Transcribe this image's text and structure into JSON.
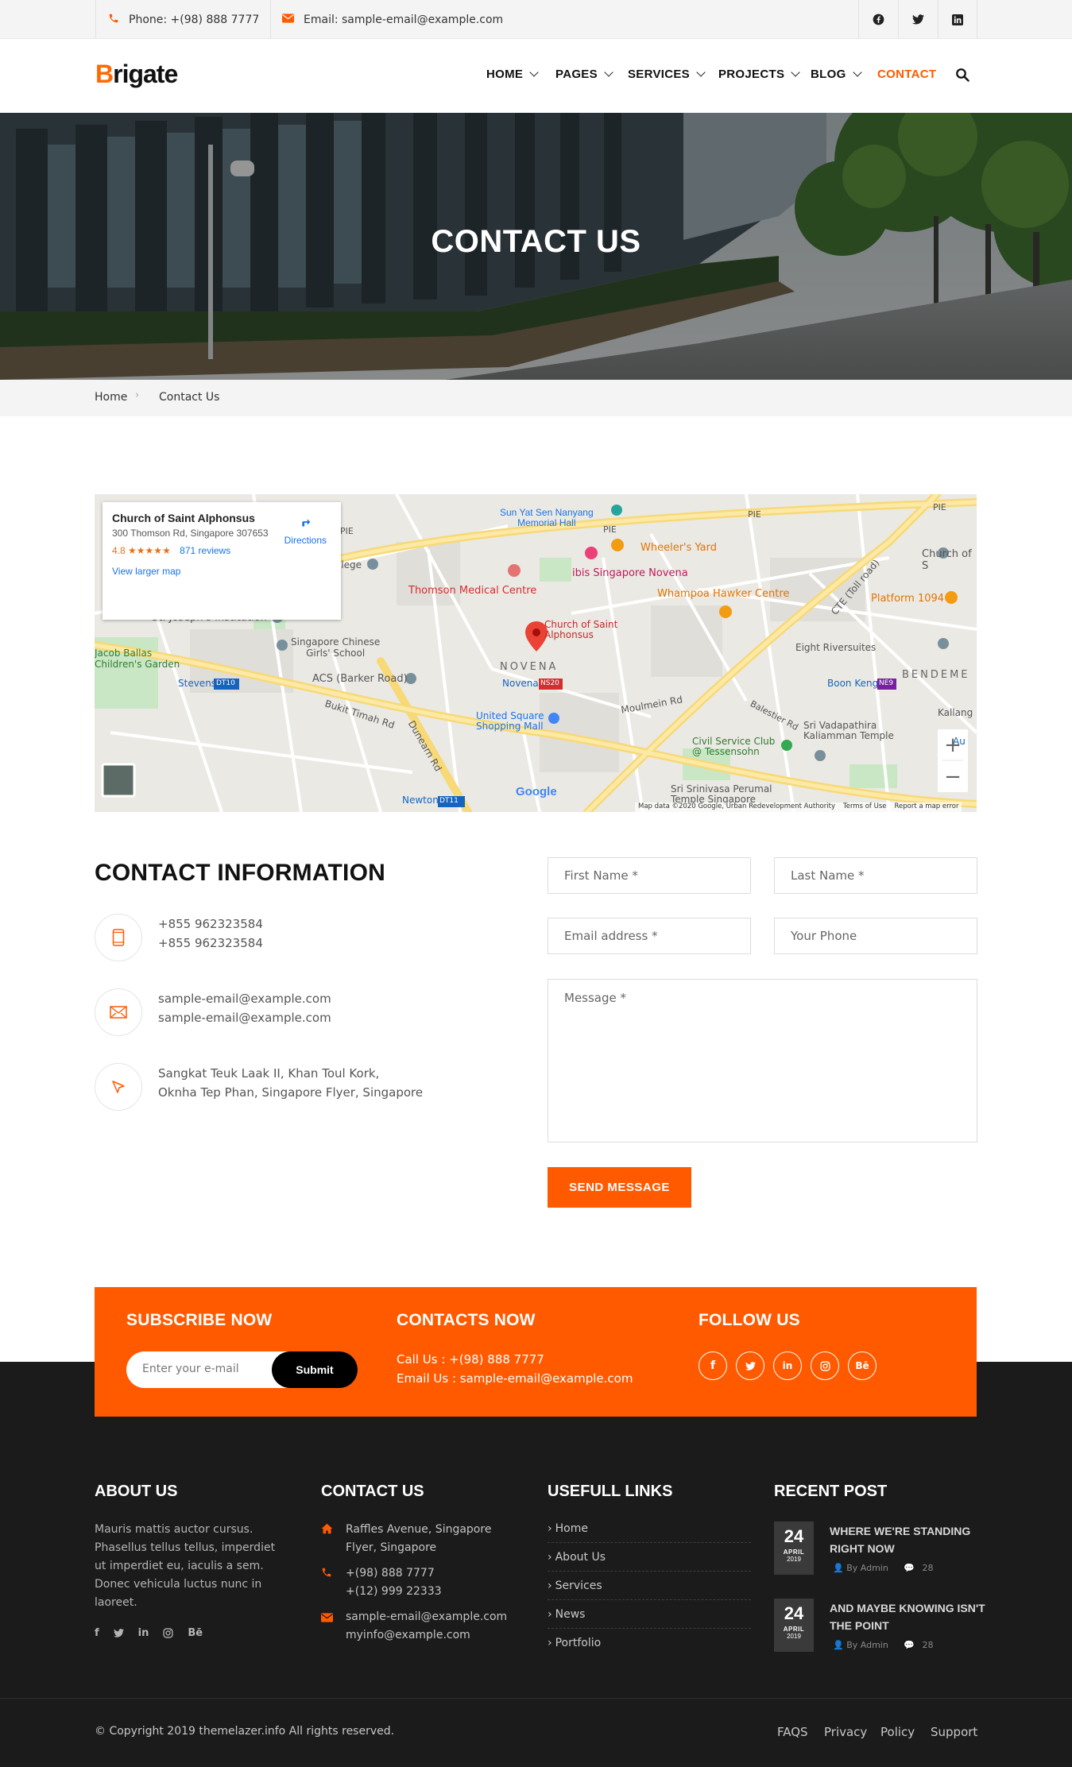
{
  "topbar": {
    "phone": "Phone: +(98) 888 7777",
    "email": "Email: sample-email@example.com",
    "social": [
      "facebook-icon",
      "twitter-icon",
      "linkedin-icon"
    ]
  },
  "header": {
    "logo_first": "B",
    "logo_rest": "rigate",
    "nav": [
      {
        "label": "HOME",
        "dropdown": true
      },
      {
        "label": "PAGES",
        "dropdown": true
      },
      {
        "label": "SERVICES",
        "dropdown": true
      },
      {
        "label": "PROJECTS",
        "dropdown": true
      },
      {
        "label": "BLOG",
        "dropdown": true
      },
      {
        "label": "CONTACT",
        "dropdown": false,
        "active": true
      }
    ]
  },
  "hero": {
    "title": "CONTACT US"
  },
  "breadcrumb": {
    "home": "Home",
    "current": "Contact Us"
  },
  "map": {
    "place": "Church of Saint Alphonsus",
    "address": "300 Thomson Rd, Singapore 307653",
    "rating": "4.8",
    "stars": "★★★★★",
    "reviews": "871 reviews",
    "directions": "Directions",
    "larger": "View larger map",
    "pin_label_1": "Church of Saint",
    "pin_label_2": "Alphonsus",
    "labels": {
      "sun_yat_1": "Sun Yat Sen Nanyang",
      "sun_yat_2": "Memorial Hall",
      "wheelers": "Wheeler's Yard",
      "ibis": "ibis Singapore Novena",
      "thomson": "Thomson Medical Centre",
      "whampoa": "Whampoa Hawker Centre",
      "platform": "Platform 1094",
      "church_s": "Church of S",
      "stjoseph": "St. Joseph's Institution",
      "spcgs_1": "Singapore Chinese",
      "spcgs_2": "Girls' School",
      "jacob_1": "Jacob Ballas",
      "jacob_2": "Children's Garden",
      "eight": "Eight Riversuites",
      "novena": "NOVENA",
      "novena_mrt": "Novena",
      "stevens": "Stevens",
      "acs": "ACS (Barker Road)",
      "boon": "Boon Keng",
      "bendemeer": "BENDEME",
      "kallang": "Kallang",
      "united_1": "United Square",
      "united_2": "Shopping Mall",
      "civil_1": "Civil Service Club",
      "civil_2": "@ Tessensohn",
      "sri_1": "Sri Vadapathira",
      "sri_2": "Kaliamman Temple",
      "srini_1": "Sri Srinivasa Perumal",
      "srini_2": "Temple Singapore",
      "newton": "Newton",
      "bukit": "Bukit Timah Rd",
      "dunearn": "Dunearn Rd",
      "moulmein": "Moulmein Rd",
      "balestier": "Balestier Rd",
      "cte": "CTE (Toll road)",
      "pie_1": "PIE",
      "pie_2": "PIE",
      "pie_3": "PIE",
      "pie_4": "PIE",
      "dt10": "DT10",
      "ns20": "NS20",
      "ne9": "NE9",
      "dt11": "DT11",
      "college": "llege",
      "au": "Au"
    },
    "google": "Google",
    "attribution": "Map data ©2020 Google, Urban Redevelopment Authority",
    "terms": "Terms of Use",
    "report": "Report a map error",
    "zoom_in": "+",
    "zoom_out": "−"
  },
  "contact_info": {
    "title": "CONTACT INFORMATION",
    "phone_1": "+855 962323584",
    "phone_2": "+855 962323584",
    "email_1": "sample-email@example.com",
    "email_2": "sample-email@example.com",
    "address_1": "Sangkat Teuk Laak II, Khan Toul Kork,",
    "address_2": "Oknha Tep Phan, Singapore Flyer, Singapore"
  },
  "form": {
    "first_name": "First Name *",
    "last_name": "Last Name *",
    "email": "Email address *",
    "phone": "Your Phone",
    "message": "Message *",
    "submit": "SEND MESSAGE"
  },
  "band": {
    "subscribe_title": "SUBSCRIBE NOW",
    "subscribe_placeholder": "Enter your e-mail",
    "subscribe_button": "Submit",
    "contacts_title": "CONTACTS NOW",
    "call": "Call Us : +(98) 888 7777",
    "email": "Email Us : sample-email@example.com",
    "follow_title": "FOLLOW US",
    "social": [
      "f",
      "t",
      "in",
      "ig",
      "Bē"
    ]
  },
  "footer": {
    "about_title": "ABOUT US",
    "about_text": [
      "Mauris mattis auctor cursus.",
      "Phasellus tellus tellus, imperdiet",
      "ut imperdiet eu, iaculis a sem.",
      "Donec vehicula luctus nunc in",
      "laoreet."
    ],
    "about_social": [
      "f",
      "t",
      "in",
      "ig",
      "Bē"
    ],
    "contact_title": "CONTACT US",
    "addr_1": "Raffles Avenue, Singapore",
    "addr_2": "Flyer, Singapore",
    "tel_1": "+(98) 888 7777",
    "tel_2": "+(12) 999 22333",
    "mail_1": "sample-email@example.com",
    "mail_2": "myinfo@example.com",
    "links_title": "USEFULL LINKS",
    "links": [
      "Home",
      "About Us",
      "Services",
      "News",
      "Portfolio"
    ],
    "recent_title": "RECENT POST",
    "posts": [
      {
        "day": "24",
        "month": "APRIL",
        "year": "2019",
        "title_1": "WHERE WE'RE STANDING",
        "title_2": "RIGHT NOW",
        "author": "By Admin",
        "comments": "28"
      },
      {
        "day": "24",
        "month": "APRIL",
        "year": "2019",
        "title_1": "AND MAYBE KNOWING ISN'T",
        "title_2": "THE POINT",
        "author": "By Admin",
        "comments": "28"
      }
    ],
    "copyright": "© Copyright 2019 themelazer.info All rights reserved.",
    "bottom_links": [
      "FAQS",
      "Privacy",
      "Policy",
      "Support"
    ]
  },
  "colors": {
    "accent": "#ff5a00",
    "dark": "#1b1b1b",
    "topbar": "#f4f4f4"
  }
}
